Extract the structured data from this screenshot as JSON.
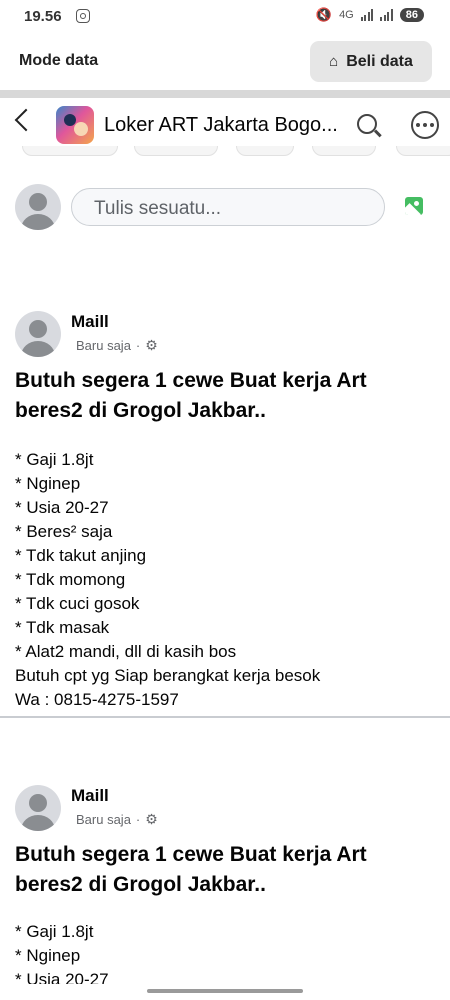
{
  "status_bar": {
    "time": "19.56",
    "network": "4G",
    "battery": "86"
  },
  "data_bar": {
    "label": "Mode data",
    "button_label": "Beli data"
  },
  "group_header": {
    "title": "Loker ART Jakarta Bogo..."
  },
  "composer": {
    "placeholder": "Tulis sesuatu..."
  },
  "posts": [
    {
      "author": "Maill",
      "time": "Baru saja",
      "separator": "·",
      "title_lines": [
        "Butuh segera 1 cewe Buat kerja Art",
        "beres2 di Grogol Jakbar.."
      ],
      "body_lines": [
        "* Gaji 1.8jt",
        "* Nginep",
        "* Usia 20-27",
        "* Beres² saja",
        "* Tdk takut anjing",
        "* Tdk momong",
        "* Tdk cuci gosok",
        "* Tdk masak",
        "* Alat2 mandi, dll di kasih bos",
        "Butuh cpt yg Siap berangkat kerja besok",
        "Wa : 0815-4275-1597"
      ]
    },
    {
      "author": "Maill",
      "time": "Baru saja",
      "separator": "·",
      "title_lines": [
        "Butuh segera 1 cewe Buat kerja Art",
        "beres2 di Grogol Jakbar.."
      ],
      "body_lines": [
        "* Gaji 1.8jt",
        "* Nginep",
        "* Usia 20-27"
      ]
    }
  ]
}
